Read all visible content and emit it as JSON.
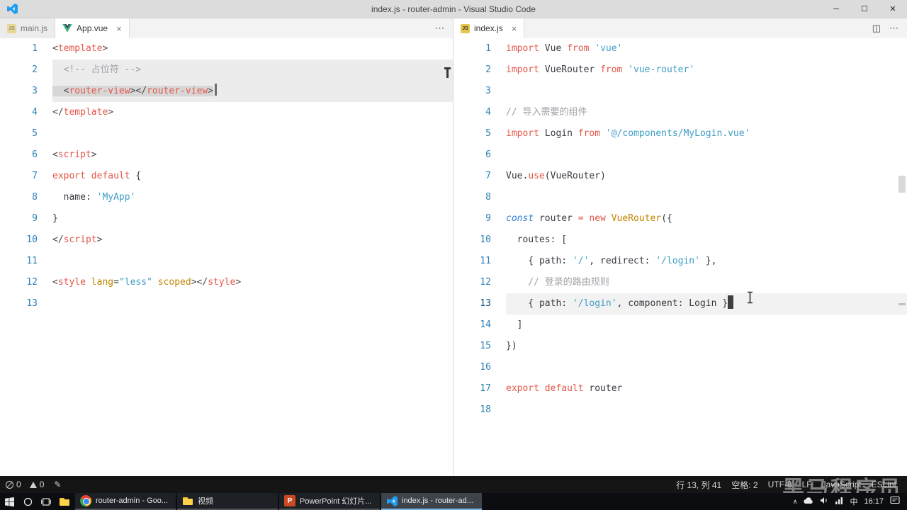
{
  "title_bar": {
    "title": "index.js - router-admin - Visual Studio Code",
    "minimize": "─",
    "maximize": "☐",
    "close": "✕"
  },
  "tab_actions": {
    "more": "⋯",
    "split": "◫"
  },
  "editor_groups": [
    {
      "name": "left",
      "tabs": [
        {
          "label": "main.js",
          "icon": "js",
          "active": false
        },
        {
          "label": "App.vue",
          "icon": "vue",
          "active": true,
          "close": "×"
        }
      ],
      "lines": [
        {
          "n": 1,
          "tokens": [
            [
              "p",
              "<"
            ],
            [
              "tag",
              "template"
            ],
            [
              "p",
              ">"
            ]
          ]
        },
        {
          "n": 2,
          "tokens": [
            [
              "c",
              "  <!-- 占位符 -->"
            ]
          ],
          "hl": "rowsel"
        },
        {
          "n": 3,
          "tokens": [
            [
              "p",
              "  <"
            ],
            [
              "tag",
              "router-view"
            ],
            [
              "p",
              "></"
            ],
            [
              "tag",
              "router-view"
            ],
            [
              "p",
              ">"
            ]
          ],
          "hl": "sel"
        },
        {
          "n": 4,
          "tokens": [
            [
              "p",
              "</"
            ],
            [
              "tag",
              "template"
            ],
            [
              "p",
              ">"
            ]
          ]
        },
        {
          "n": 5,
          "tokens": []
        },
        {
          "n": 6,
          "tokens": [
            [
              "p",
              "<"
            ],
            [
              "tag",
              "script"
            ],
            [
              "p",
              ">"
            ]
          ]
        },
        {
          "n": 7,
          "tokens": [
            [
              "k",
              "export default"
            ],
            [
              "d",
              " {"
            ]
          ]
        },
        {
          "n": 8,
          "tokens": [
            [
              "d",
              "  name: "
            ],
            [
              "s",
              "'MyApp'"
            ]
          ]
        },
        {
          "n": 9,
          "tokens": [
            [
              "d",
              "}"
            ]
          ]
        },
        {
          "n": 10,
          "tokens": [
            [
              "p",
              "</"
            ],
            [
              "tag",
              "script"
            ],
            [
              "p",
              ">"
            ]
          ]
        },
        {
          "n": 11,
          "tokens": []
        },
        {
          "n": 12,
          "tokens": [
            [
              "p",
              "<"
            ],
            [
              "tag",
              "style"
            ],
            [
              "d",
              " "
            ],
            [
              "attr",
              "lang"
            ],
            [
              "d",
              "="
            ],
            [
              "s",
              "\"less\""
            ],
            [
              "d",
              " "
            ],
            [
              "attr",
              "scoped"
            ],
            [
              "p",
              "></"
            ],
            [
              "tag",
              "style"
            ],
            [
              "p",
              ">"
            ]
          ]
        },
        {
          "n": 13,
          "tokens": []
        }
      ]
    },
    {
      "name": "right",
      "tabs": [
        {
          "label": "index.js",
          "icon": "js",
          "active": true,
          "close": "×"
        }
      ],
      "lines": [
        {
          "n": 1,
          "tokens": [
            [
              "k",
              "import"
            ],
            [
              "d",
              " Vue "
            ],
            [
              "k",
              "from"
            ],
            [
              "d",
              " "
            ],
            [
              "s",
              "'vue'"
            ]
          ]
        },
        {
          "n": 2,
          "tokens": [
            [
              "k",
              "import"
            ],
            [
              "d",
              " VueRouter "
            ],
            [
              "k",
              "from"
            ],
            [
              "d",
              " "
            ],
            [
              "s",
              "'vue-router'"
            ]
          ]
        },
        {
          "n": 3,
          "tokens": []
        },
        {
          "n": 4,
          "tokens": [
            [
              "c",
              "// 导入需要的组件"
            ]
          ]
        },
        {
          "n": 5,
          "tokens": [
            [
              "k",
              "import"
            ],
            [
              "d",
              " Login "
            ],
            [
              "k",
              "from"
            ],
            [
              "d",
              " "
            ],
            [
              "s",
              "'@/components/MyLogin.vue'"
            ]
          ]
        },
        {
          "n": 6,
          "tokens": []
        },
        {
          "n": 7,
          "tokens": [
            [
              "d",
              "Vue."
            ],
            [
              "k",
              "use"
            ],
            [
              "d",
              "(VueRouter)"
            ]
          ]
        },
        {
          "n": 8,
          "tokens": []
        },
        {
          "n": 9,
          "tokens": [
            [
              "b",
              "const"
            ],
            [
              "d",
              " router "
            ],
            [
              "k",
              "="
            ],
            [
              "d",
              " "
            ],
            [
              "k",
              "new"
            ],
            [
              "d",
              " "
            ],
            [
              "cls",
              "VueRouter"
            ],
            [
              "d",
              "({"
            ]
          ]
        },
        {
          "n": 10,
          "tokens": [
            [
              "d",
              "  routes: ["
            ]
          ]
        },
        {
          "n": 11,
          "tokens": [
            [
              "d",
              "    { path: "
            ],
            [
              "s",
              "'/'"
            ],
            [
              "d",
              ", redirect: "
            ],
            [
              "s",
              "'/login'"
            ],
            [
              "d",
              " },"
            ]
          ]
        },
        {
          "n": 12,
          "tokens": [
            [
              "c",
              "    // 登录的路由规则"
            ]
          ]
        },
        {
          "n": 13,
          "tokens": [
            [
              "d",
              "    { path: "
            ],
            [
              "s",
              "'/login'"
            ],
            [
              "d",
              ", component: Login }"
            ]
          ],
          "hl": "cur"
        },
        {
          "n": 14,
          "tokens": [
            [
              "d",
              "  ]"
            ]
          ]
        },
        {
          "n": 15,
          "tokens": [
            [
              "d",
              "})"
            ]
          ]
        },
        {
          "n": 16,
          "tokens": []
        },
        {
          "n": 17,
          "tokens": [
            [
              "k",
              "export default"
            ],
            [
              "d",
              " router"
            ]
          ]
        },
        {
          "n": 18,
          "tokens": []
        }
      ]
    }
  ],
  "status_bar": {
    "errors": "0",
    "warnings": "0",
    "right_items": [
      "行 13, 列 41",
      "空格: 2",
      "UTF-8",
      "LF",
      "JavaScript",
      "ESLint"
    ]
  },
  "watermark": "黑马程序员",
  "taskbar": {
    "buttons": [
      {
        "icon": "chrome",
        "label": "router-admin - Goo..."
      },
      {
        "icon": "folder",
        "label": "视频"
      },
      {
        "icon": "powerpoint",
        "label": "PowerPoint 幻灯片..."
      },
      {
        "icon": "vscode",
        "label": "index.js - router-ad...",
        "active": true
      }
    ],
    "time": "16:17",
    "ime": "中"
  }
}
